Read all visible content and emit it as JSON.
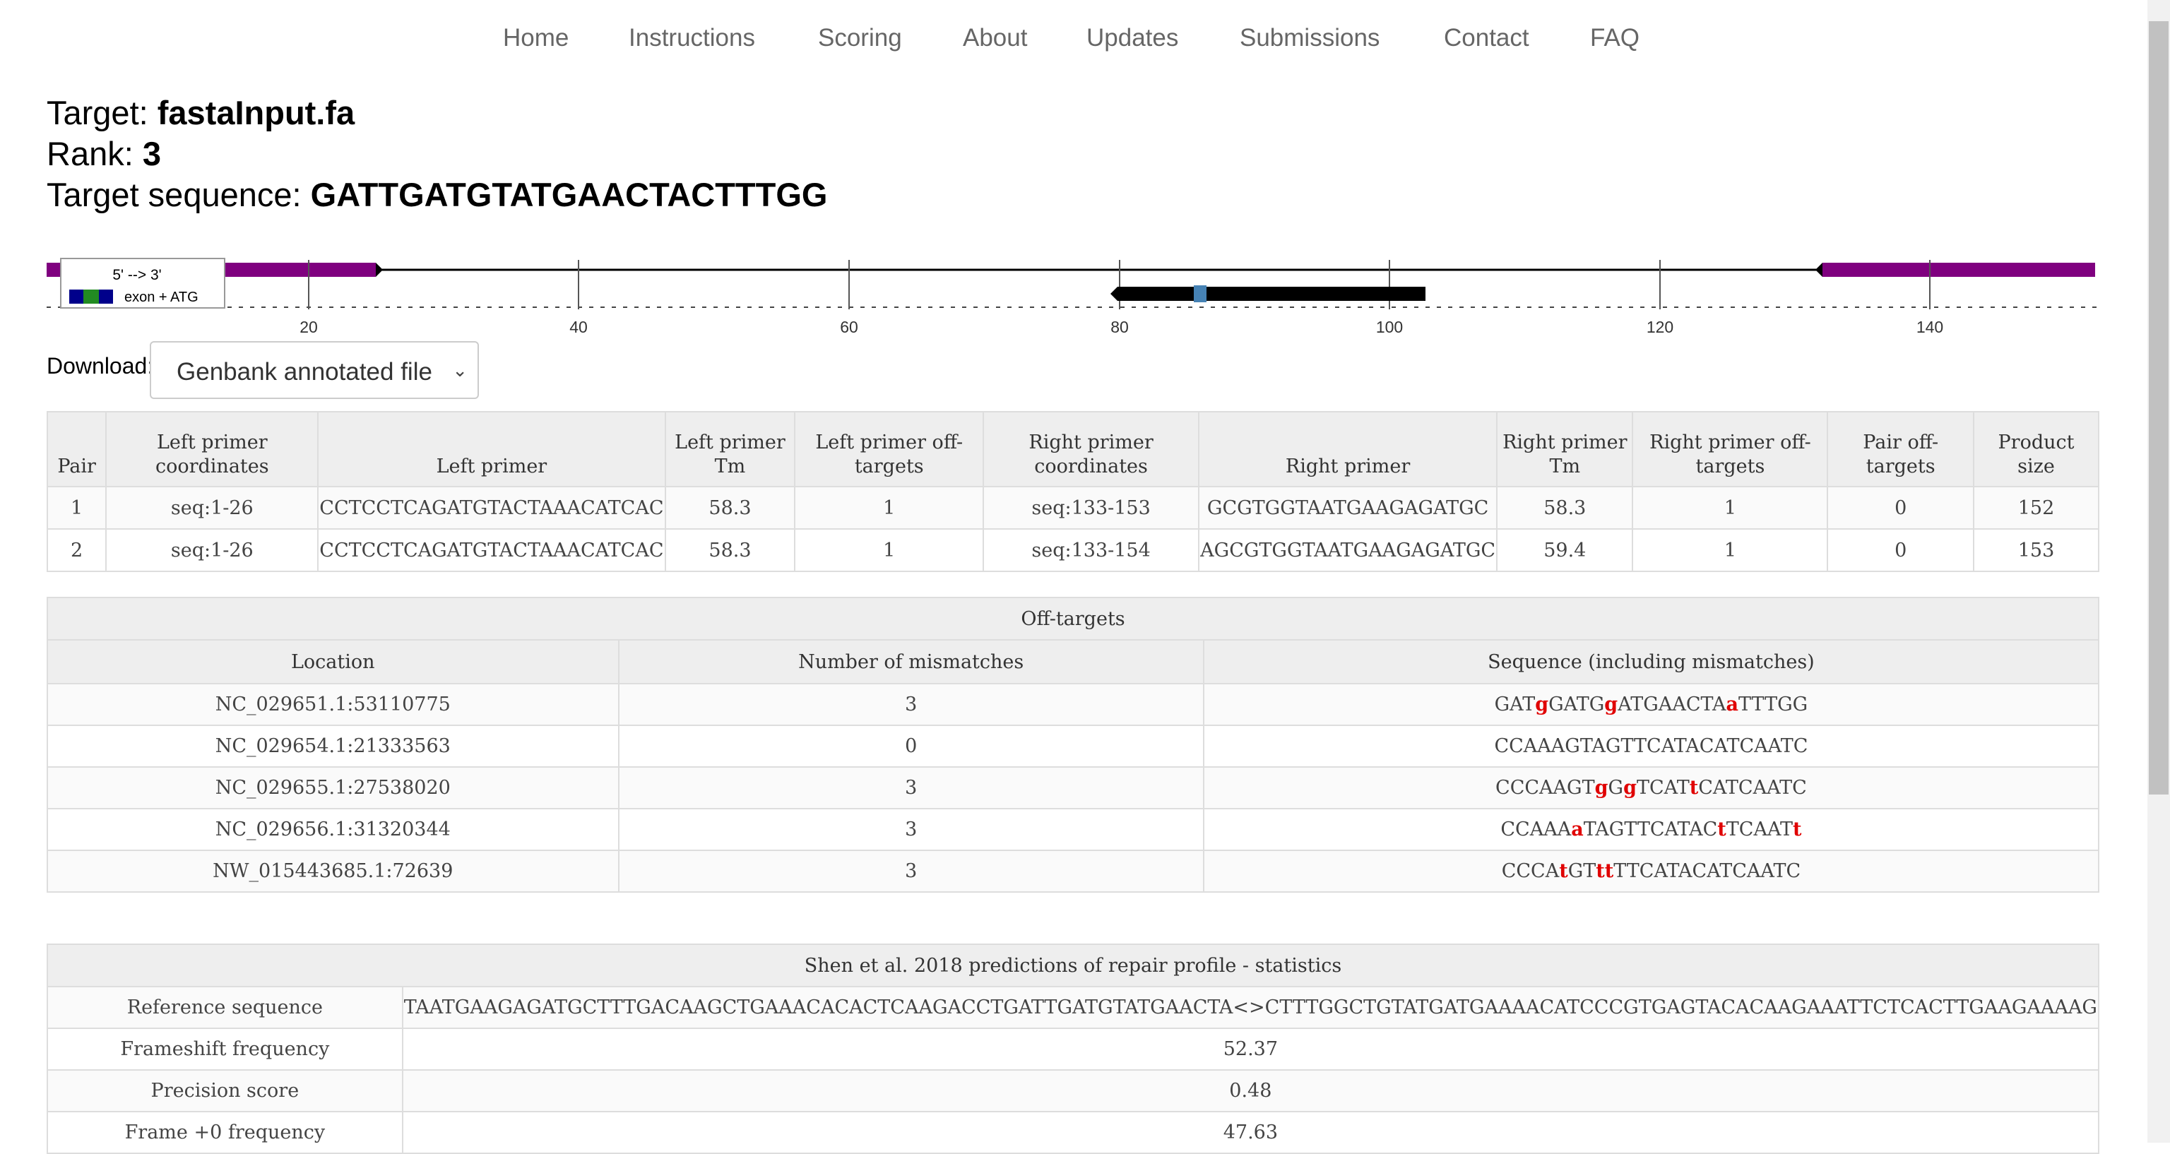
{
  "nav": [
    "Home",
    "Instructions",
    "Scoring",
    "About",
    "Updates",
    "Submissions",
    "Contact",
    "FAQ"
  ],
  "header": {
    "target_label": "Target:",
    "target_value": "fastaInput.fa",
    "rank_label": "Rank:",
    "rank_value": "3",
    "seq_label": "Target sequence:",
    "seq_value": "GATTGATGTATGAACTACTTTGG"
  },
  "map": {
    "legend_title": "5' --> 3'",
    "legend_label": "exon + ATG",
    "ticks": [
      "20",
      "40",
      "60",
      "80",
      "100",
      "120",
      "140"
    ],
    "colors": {
      "exon": "#7f007f",
      "guide": "#000000",
      "cut": "#4682b4",
      "legend_blue": "#00008b",
      "legend_green": "#228b22"
    }
  },
  "download": {
    "label": "Download:",
    "selected": "Genbank annotated file"
  },
  "primers": {
    "headers": [
      "Pair",
      "Left primer coordinates",
      "Left primer",
      "Left primer Tm",
      "Left primer off-targets",
      "Right primer coordinates",
      "Right primer",
      "Right primer Tm",
      "Right primer off-targets",
      "Pair off-targets",
      "Product size"
    ],
    "rows": [
      [
        "1",
        "seq:1-26",
        "CCTCCTCAGATGTACTAAACATCAC",
        "58.3",
        "1",
        "seq:133-153",
        "GCGTGGTAATGAAGAGATGC",
        "58.3",
        "1",
        "0",
        "152"
      ],
      [
        "2",
        "seq:1-26",
        "CCTCCTCAGATGTACTAAACATCAC",
        "58.3",
        "1",
        "seq:133-154",
        "AGCGTGGTAATGAAGAGATGC",
        "59.4",
        "1",
        "0",
        "153"
      ]
    ]
  },
  "offtargets": {
    "caption": "Off-targets",
    "headers": [
      "Location",
      "Number of mismatches",
      "Sequence (including mismatches)"
    ],
    "rows": [
      {
        "location": "NC_029651.1:53110775",
        "mismatches": "3",
        "sequence": "GATgGATGgATGAACTAaTTTGG"
      },
      {
        "location": "NC_029654.1:21333563",
        "mismatches": "0",
        "sequence": "CCAAAGTAGTTCATACATCAATC"
      },
      {
        "location": "NC_029655.1:27538020",
        "mismatches": "3",
        "sequence": "CCCAAGTgGgTCATtCATCAATC"
      },
      {
        "location": "NC_029656.1:31320344",
        "mismatches": "3",
        "sequence": "CCAAAaTAGTTCATACtTCAATt"
      },
      {
        "location": "NW_015443685.1:72639",
        "mismatches": "3",
        "sequence": "CCCAtGTttTTCATACATCAATC"
      }
    ]
  },
  "shen": {
    "caption": "Shen et al. 2018 predictions of repair profile - statistics",
    "rows": [
      {
        "label": "Reference sequence",
        "value": "TAATGAAGAGATGCTTTGACAAGCTGAAACACACTCAAGACCTGATTGATGTATGAACTA<>CTTTGGCTGTATGATGAAAACATCCCGTGAGTACACAAGAAATTCTCACTTGAAGAAAAG"
      },
      {
        "label": "Frameshift frequency",
        "value": "52.37"
      },
      {
        "label": "Precision score",
        "value": "0.48"
      },
      {
        "label": "Frame +0 frequency",
        "value": "47.63"
      }
    ]
  }
}
